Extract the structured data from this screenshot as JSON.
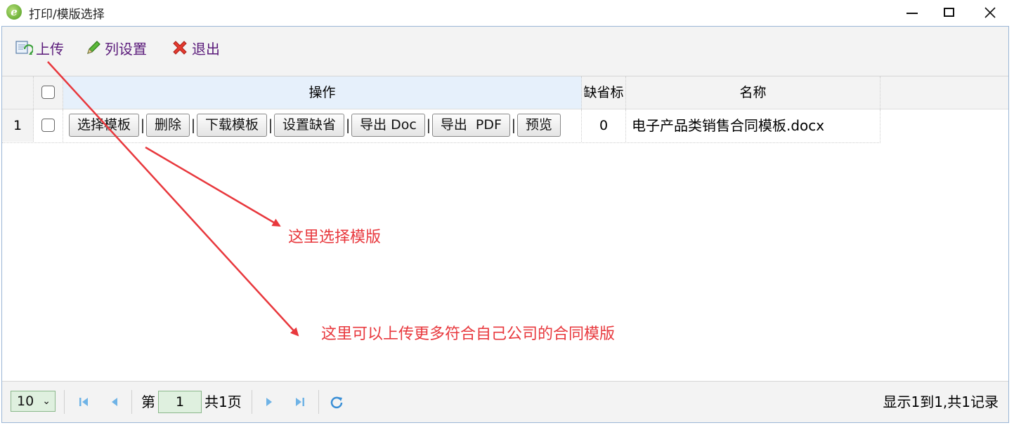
{
  "window": {
    "title": "打印/模版选择",
    "app_icon_letter": "e"
  },
  "toolbar": {
    "upload_label": "上传",
    "columns_label": "列设置",
    "exit_label": "退出"
  },
  "table": {
    "headers": {
      "operations": "操作",
      "default": "缺省标",
      "name": "名称"
    },
    "rows": [
      {
        "row_number": "1",
        "operations": [
          "选择模板",
          "删除",
          "下载模板",
          "设置缺省",
          "导出 Doc",
          "导出  PDF",
          "预览"
        ],
        "separator": "|",
        "default": "0",
        "name": "电子产品类销售合同模板.docx"
      }
    ]
  },
  "annotations": {
    "select_template": "这里选择模版",
    "upload_more": "这里可以上传更多符合自己公司的合同模版"
  },
  "pager": {
    "page_size": "10",
    "page_prefix": "第",
    "current_page": "1",
    "page_suffix": "共1页",
    "summary": "显示1到1,共1记录"
  },
  "colors": {
    "annotation": "#e8383d",
    "toolbar_text": "#5a1a7a",
    "header_highlight": "#e6f0fb",
    "pager_input": "#dff0df"
  }
}
